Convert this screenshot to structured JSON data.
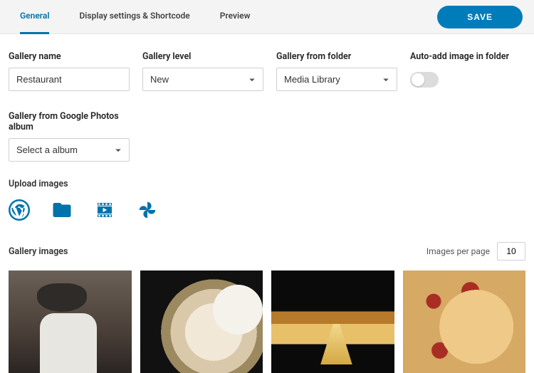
{
  "tabs": {
    "general": "General",
    "display": "Display settings & Shortcode",
    "preview": "Preview"
  },
  "buttons": {
    "save": "SAVE"
  },
  "fields": {
    "name": {
      "label": "Gallery name",
      "value": "Restaurant"
    },
    "level": {
      "label": "Gallery level",
      "value": "New"
    },
    "folder": {
      "label": "Gallery from folder",
      "value": "Media Library"
    },
    "autoadd": {
      "label": "Auto-add image in folder",
      "on": false
    },
    "googlephotos": {
      "label": "Gallery from Google Photos album",
      "value": "Select a album"
    }
  },
  "upload": {
    "label": "Upload images",
    "sources": [
      "wordpress",
      "folder",
      "video",
      "google-photos"
    ]
  },
  "gallery": {
    "title": "Gallery images",
    "ipp_label": "Images per page",
    "ipp_value": "10"
  }
}
